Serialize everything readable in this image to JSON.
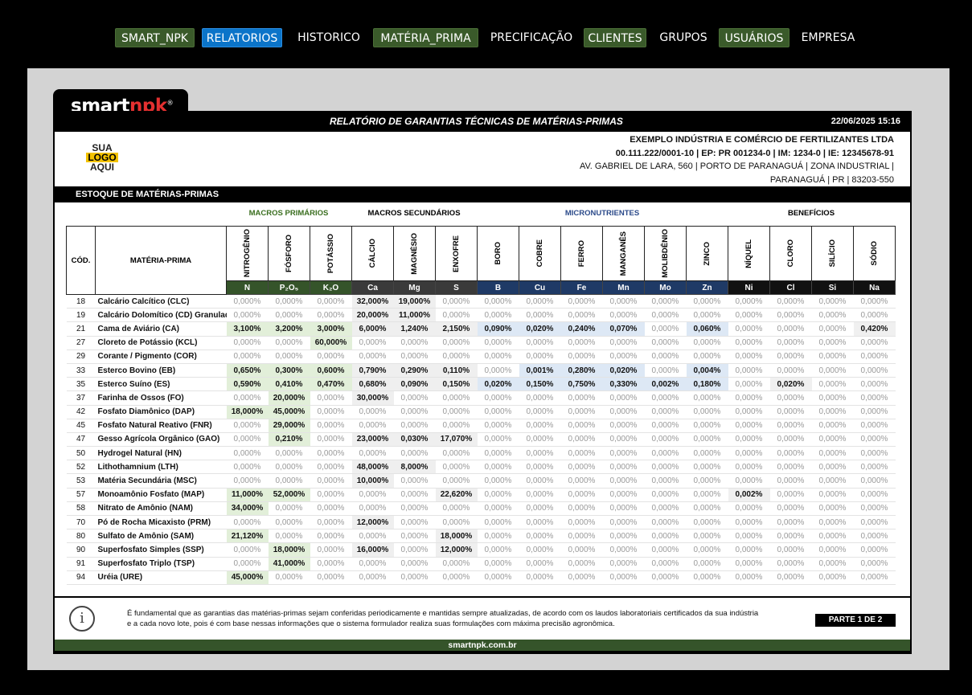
{
  "nav": [
    {
      "label": "SMART_NPK",
      "style": "green"
    },
    {
      "label": "RELATORIOS",
      "style": "blue"
    },
    {
      "label": "HISTORICO",
      "style": "plain"
    },
    {
      "label": "MATÉRIA_PRIMA",
      "style": "green"
    },
    {
      "label": "PRECIFICAÇÃO",
      "style": "plain"
    },
    {
      "label": "CLIENTES",
      "style": "green"
    },
    {
      "label": "GRUPOS",
      "style": "plain"
    },
    {
      "label": "USUÁRIOS",
      "style": "green"
    },
    {
      "label": "EMPRESA",
      "style": "plain"
    }
  ],
  "brand": {
    "logo_main": "smart",
    "logo_accent": "npk",
    "logo_mark": "®"
  },
  "report": {
    "title": "RELATÓRIO DE GARANTIAS TÉCNICAS DE MATÉRIAS-PRIMAS",
    "date": "22/06/2025 15:16",
    "client_logo": {
      "line1": "SUA",
      "line2": "LOGO",
      "line3": "AQUI"
    },
    "company": {
      "name": "EXEMPLO INDÚSTRIA E COMÉRCIO DE FERTILIZANTES LTDA",
      "ids": "00.111.222/0001-10 | EP: PR 001234-0 | IM: 1234-0 | IE: 12345678-91",
      "address1": "AV. GABRIEL DE LARA, 560 | PORTO DE PARANAGUÁ | ZONA INDUSTRIAL |",
      "address2": "PARANAGUÁ | PR | 83203-550"
    },
    "section_title": "ESTOQUE DE MATÉRIAS-PRIMAS",
    "groups": [
      {
        "label": "MACROS PRIMÁRIOS",
        "color": "#3a6e1f"
      },
      {
        "label": "MACROS SECUNDÁRIOS",
        "color": "#000000"
      },
      {
        "label": "MICRONUTRIENTES",
        "color": "#2b4a8a"
      },
      {
        "label": "BENEFÍCIOS",
        "color": "#000000"
      }
    ],
    "col_code": "CÓD.",
    "col_name": "MATÉRIA-PRIMA",
    "nutrients": [
      {
        "name": "NITROGÊNIO",
        "sym": "N",
        "sym_bg": "#35542a",
        "hi_bg": "#e2efd9"
      },
      {
        "name": "FÓSFORO",
        "sym": "P₂O₅",
        "sym_bg": "#35542a",
        "hi_bg": "#e2efd9"
      },
      {
        "name": "POTÁSSIO",
        "sym": "K₂O",
        "sym_bg": "#35542a",
        "hi_bg": "#e2efd9"
      },
      {
        "name": "CÁLCIO",
        "sym": "Ca",
        "sym_bg": "#3a3a3a",
        "hi_bg": "#efefef"
      },
      {
        "name": "MAGNÉSIO",
        "sym": "Mg",
        "sym_bg": "#3a3a3a",
        "hi_bg": "#efefef"
      },
      {
        "name": "ENXOFRE",
        "sym": "S",
        "sym_bg": "#3a3a3a",
        "hi_bg": "#efefef"
      },
      {
        "name": "BORO",
        "sym": "B",
        "sym_bg": "#1f3a66",
        "hi_bg": "#dde8f5"
      },
      {
        "name": "COBRE",
        "sym": "Cu",
        "sym_bg": "#1f3a66",
        "hi_bg": "#dde8f5"
      },
      {
        "name": "FERRO",
        "sym": "Fe",
        "sym_bg": "#1f3a66",
        "hi_bg": "#dde8f5"
      },
      {
        "name": "MANGANÊS",
        "sym": "Mn",
        "sym_bg": "#1f3a66",
        "hi_bg": "#dde8f5"
      },
      {
        "name": "MOLIBDÊNIO",
        "sym": "Mo",
        "sym_bg": "#1f3a66",
        "hi_bg": "#dde8f5"
      },
      {
        "name": "ZINCO",
        "sym": "Zn",
        "sym_bg": "#1f3a66",
        "hi_bg": "#dde8f5"
      },
      {
        "name": "NÍQUEL",
        "sym": "Ni",
        "sym_bg": "#111111",
        "hi_bg": "#f0f0f0"
      },
      {
        "name": "CLORO",
        "sym": "Cl",
        "sym_bg": "#111111",
        "hi_bg": "#f0f0f0"
      },
      {
        "name": "SILÍCIO",
        "sym": "Si",
        "sym_bg": "#111111",
        "hi_bg": "#f0f0f0"
      },
      {
        "name": "SÓDIO",
        "sym": "Na",
        "sym_bg": "#111111",
        "hi_bg": "#f0f0f0"
      }
    ],
    "rows": [
      {
        "code": "18",
        "name": "Calcário Calcítico (CLC)",
        "v": [
          "0,000%",
          "0,000%",
          "0,000%",
          "32,000%",
          "19,000%",
          "0,000%",
          "0,000%",
          "0,000%",
          "0,000%",
          "0,000%",
          "0,000%",
          "0,000%",
          "0,000%",
          "0,000%",
          "0,000%",
          "0,000%"
        ]
      },
      {
        "code": "19",
        "name": "Calcário Dolomítico (CD) Granulado",
        "v": [
          "0,000%",
          "0,000%",
          "0,000%",
          "20,000%",
          "11,000%",
          "0,000%",
          "0,000%",
          "0,000%",
          "0,000%",
          "0,000%",
          "0,000%",
          "0,000%",
          "0,000%",
          "0,000%",
          "0,000%",
          "0,000%"
        ]
      },
      {
        "code": "21",
        "name": "Cama de Aviário (CA)",
        "v": [
          "3,100%",
          "3,200%",
          "3,000%",
          "6,000%",
          "1,240%",
          "2,150%",
          "0,090%",
          "0,020%",
          "0,240%",
          "0,070%",
          "0,000%",
          "0,060%",
          "0,000%",
          "0,000%",
          "0,000%",
          "0,420%"
        ]
      },
      {
        "code": "27",
        "name": "Cloreto de Potássio (KCL)",
        "v": [
          "0,000%",
          "0,000%",
          "60,000%",
          "0,000%",
          "0,000%",
          "0,000%",
          "0,000%",
          "0,000%",
          "0,000%",
          "0,000%",
          "0,000%",
          "0,000%",
          "0,000%",
          "0,000%",
          "0,000%",
          "0,000%"
        ]
      },
      {
        "code": "29",
        "name": "Corante / Pigmento (COR)",
        "v": [
          "0,000%",
          "0,000%",
          "0,000%",
          "0,000%",
          "0,000%",
          "0,000%",
          "0,000%",
          "0,000%",
          "0,000%",
          "0,000%",
          "0,000%",
          "0,000%",
          "0,000%",
          "0,000%",
          "0,000%",
          "0,000%"
        ]
      },
      {
        "code": "33",
        "name": "Esterco Bovino (EB)",
        "v": [
          "0,650%",
          "0,300%",
          "0,600%",
          "0,790%",
          "0,290%",
          "0,110%",
          "0,000%",
          "0,001%",
          "0,280%",
          "0,020%",
          "0,000%",
          "0,004%",
          "0,000%",
          "0,000%",
          "0,000%",
          "0,000%"
        ]
      },
      {
        "code": "35",
        "name": "Esterco Suíno (ES)",
        "v": [
          "0,590%",
          "0,410%",
          "0,470%",
          "0,680%",
          "0,090%",
          "0,150%",
          "0,020%",
          "0,150%",
          "0,750%",
          "0,330%",
          "0,002%",
          "0,180%",
          "0,000%",
          "0,020%",
          "0,000%",
          "0,000%"
        ]
      },
      {
        "code": "37",
        "name": "Farinha de Ossos (FO)",
        "v": [
          "0,000%",
          "20,000%",
          "0,000%",
          "30,000%",
          "0,000%",
          "0,000%",
          "0,000%",
          "0,000%",
          "0,000%",
          "0,000%",
          "0,000%",
          "0,000%",
          "0,000%",
          "0,000%",
          "0,000%",
          "0,000%"
        ]
      },
      {
        "code": "42",
        "name": "Fosfato Diamônico (DAP)",
        "v": [
          "18,000%",
          "45,000%",
          "0,000%",
          "0,000%",
          "0,000%",
          "0,000%",
          "0,000%",
          "0,000%",
          "0,000%",
          "0,000%",
          "0,000%",
          "0,000%",
          "0,000%",
          "0,000%",
          "0,000%",
          "0,000%"
        ]
      },
      {
        "code": "45",
        "name": "Fosfato Natural Reativo (FNR)",
        "v": [
          "0,000%",
          "29,000%",
          "0,000%",
          "0,000%",
          "0,000%",
          "0,000%",
          "0,000%",
          "0,000%",
          "0,000%",
          "0,000%",
          "0,000%",
          "0,000%",
          "0,000%",
          "0,000%",
          "0,000%",
          "0,000%"
        ]
      },
      {
        "code": "47",
        "name": "Gesso Agrícola Orgânico (GAO)",
        "v": [
          "0,000%",
          "0,210%",
          "0,000%",
          "23,000%",
          "0,030%",
          "17,070%",
          "0,000%",
          "0,000%",
          "0,000%",
          "0,000%",
          "0,000%",
          "0,000%",
          "0,000%",
          "0,000%",
          "0,000%",
          "0,000%"
        ]
      },
      {
        "code": "50",
        "name": "Hydrogel Natural (HN)",
        "v": [
          "0,000%",
          "0,000%",
          "0,000%",
          "0,000%",
          "0,000%",
          "0,000%",
          "0,000%",
          "0,000%",
          "0,000%",
          "0,000%",
          "0,000%",
          "0,000%",
          "0,000%",
          "0,000%",
          "0,000%",
          "0,000%"
        ]
      },
      {
        "code": "52",
        "name": "Lithothamnium (LTH)",
        "v": [
          "0,000%",
          "0,000%",
          "0,000%",
          "48,000%",
          "8,000%",
          "0,000%",
          "0,000%",
          "0,000%",
          "0,000%",
          "0,000%",
          "0,000%",
          "0,000%",
          "0,000%",
          "0,000%",
          "0,000%",
          "0,000%"
        ]
      },
      {
        "code": "53",
        "name": "Matéria Secundária (MSC)",
        "v": [
          "0,000%",
          "0,000%",
          "0,000%",
          "10,000%",
          "0,000%",
          "0,000%",
          "0,000%",
          "0,000%",
          "0,000%",
          "0,000%",
          "0,000%",
          "0,000%",
          "0,000%",
          "0,000%",
          "0,000%",
          "0,000%"
        ]
      },
      {
        "code": "57",
        "name": "Monoamônio Fosfato (MAP)",
        "v": [
          "11,000%",
          "52,000%",
          "0,000%",
          "0,000%",
          "0,000%",
          "22,620%",
          "0,000%",
          "0,000%",
          "0,000%",
          "0,000%",
          "0,000%",
          "0,000%",
          "0,002%",
          "0,000%",
          "0,000%",
          "0,000%"
        ]
      },
      {
        "code": "58",
        "name": "Nitrato de Amônio (NAM)",
        "v": [
          "34,000%",
          "0,000%",
          "0,000%",
          "0,000%",
          "0,000%",
          "0,000%",
          "0,000%",
          "0,000%",
          "0,000%",
          "0,000%",
          "0,000%",
          "0,000%",
          "0,000%",
          "0,000%",
          "0,000%",
          "0,000%"
        ]
      },
      {
        "code": "70",
        "name": "Pó de Rocha Micaxisto (PRM)",
        "v": [
          "0,000%",
          "0,000%",
          "0,000%",
          "12,000%",
          "0,000%",
          "0,000%",
          "0,000%",
          "0,000%",
          "0,000%",
          "0,000%",
          "0,000%",
          "0,000%",
          "0,000%",
          "0,000%",
          "0,000%",
          "0,000%"
        ]
      },
      {
        "code": "80",
        "name": "Sulfato de Amônio (SAM)",
        "v": [
          "21,120%",
          "0,000%",
          "0,000%",
          "0,000%",
          "0,000%",
          "18,000%",
          "0,000%",
          "0,000%",
          "0,000%",
          "0,000%",
          "0,000%",
          "0,000%",
          "0,000%",
          "0,000%",
          "0,000%",
          "0,000%"
        ]
      },
      {
        "code": "90",
        "name": "Superfosfato Simples (SSP)",
        "v": [
          "0,000%",
          "18,000%",
          "0,000%",
          "16,000%",
          "0,000%",
          "12,000%",
          "0,000%",
          "0,000%",
          "0,000%",
          "0,000%",
          "0,000%",
          "0,000%",
          "0,000%",
          "0,000%",
          "0,000%",
          "0,000%"
        ]
      },
      {
        "code": "91",
        "name": "Superfosfato Triplo (TSP)",
        "v": [
          "0,000%",
          "41,000%",
          "0,000%",
          "0,000%",
          "0,000%",
          "0,000%",
          "0,000%",
          "0,000%",
          "0,000%",
          "0,000%",
          "0,000%",
          "0,000%",
          "0,000%",
          "0,000%",
          "0,000%",
          "0,000%"
        ]
      },
      {
        "code": "94",
        "name": "Uréia (URE)",
        "v": [
          "45,000%",
          "0,000%",
          "0,000%",
          "0,000%",
          "0,000%",
          "0,000%",
          "0,000%",
          "0,000%",
          "0,000%",
          "0,000%",
          "0,000%",
          "0,000%",
          "0,000%",
          "0,000%",
          "0,000%",
          "0,000%"
        ]
      }
    ],
    "info_icon": "i",
    "info_text": "É fundamental que as garantias das matérias-primas sejam conferidas periodicamente e mantidas sempre atualizadas, de acordo com os laudos laboratoriais certificados da sua indústria e a cada novo lote, pois é com base nessas informações que o sistema formulador realiza suas formulações com máxima precisão agronômica.",
    "page_label": "PARTE 1 DE 2",
    "footer_url": "smartnpk.com.br"
  }
}
